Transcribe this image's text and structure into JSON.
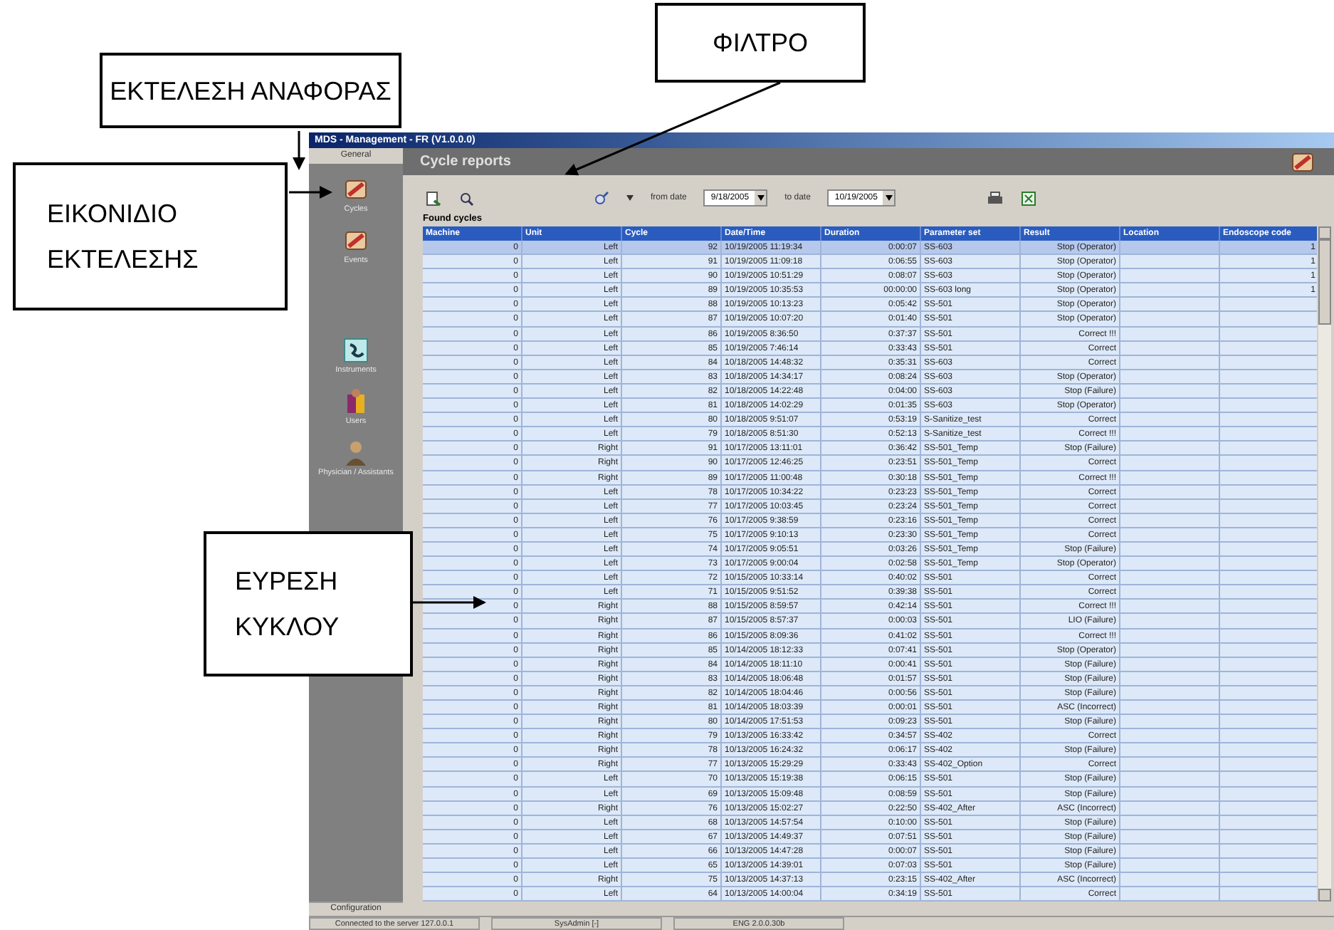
{
  "annotations": [
    {
      "text": "ΕΚΤΕΛΕΣΗ ΑΝΑΦΟΡΑΣ"
    },
    {
      "text": "ΦΙΛΤΡΟ"
    },
    {
      "text": "ΕΙΚΟΝΙΔΙΟ ΕΚΤΕΛΕΣΗΣ"
    },
    {
      "text": "ΕΥΡΕΣΗ ΚΥΚΛΟΥ"
    }
  ],
  "window": {
    "title": "MDS - Management - FR (V1.0.0.0)"
  },
  "sidebar": {
    "header": "General",
    "items": [
      {
        "label": "Cycles",
        "kind": "cycles"
      },
      {
        "label": "Events",
        "kind": "events"
      },
      {
        "label": "Instruments",
        "kind": "instruments"
      },
      {
        "label": "Users",
        "kind": "users"
      },
      {
        "label": "Physician / Assistants",
        "kind": "physician"
      }
    ],
    "footer": "Configuration"
  },
  "panel": {
    "title": "Cycle reports",
    "from_label": "from date",
    "from_date": "9/18/2005",
    "to_label": "to date",
    "to_date": "10/19/2005",
    "section": "Found cycles"
  },
  "table": {
    "columns": [
      "Machine",
      "Unit",
      "Cycle",
      "Date/Time",
      "Duration",
      "Parameter set",
      "Result",
      "Location",
      "Endoscope code"
    ],
    "rows": [
      {
        "selected": true,
        "cells": [
          "0",
          "Left",
          "92",
          "10/19/2005 11:19:34",
          "0:00:07",
          "SS-603",
          "Stop (Operator)",
          "",
          "1"
        ]
      },
      {
        "selected": false,
        "cells": [
          "0",
          "Left",
          "91",
          "10/19/2005 11:09:18",
          "0:06:55",
          "SS-603",
          "Stop (Operator)",
          "",
          "1"
        ]
      },
      {
        "selected": false,
        "cells": [
          "0",
          "Left",
          "90",
          "10/19/2005 10:51:29",
          "0:08:07",
          "SS-603",
          "Stop (Operator)",
          "",
          "1"
        ]
      },
      {
        "selected": false,
        "cells": [
          "0",
          "Left",
          "89",
          "10/19/2005 10:35:53",
          "00:00:00",
          "SS-603 long",
          "Stop (Operator)",
          "",
          "1"
        ]
      },
      {
        "selected": false,
        "cells": [
          "0",
          "Left",
          "88",
          "10/19/2005 10:13:23",
          "0:05:42",
          "SS-501",
          "Stop (Operator)",
          "",
          ""
        ]
      },
      {
        "selected": false,
        "cells": [
          "0",
          "Left",
          "87",
          "10/19/2005 10:07:20",
          "0:01:40",
          "SS-501",
          "Stop (Operator)",
          "",
          ""
        ]
      },
      {
        "selected": false,
        "cells": [
          "0",
          "Left",
          "86",
          "10/19/2005 8:36:50",
          "0:37:37",
          "SS-501",
          "Correct !!!",
          "",
          ""
        ]
      },
      {
        "selected": false,
        "cells": [
          "0",
          "Left",
          "85",
          "10/19/2005 7:46:14",
          "0:33:43",
          "SS-501",
          "Correct",
          "",
          ""
        ]
      },
      {
        "selected": false,
        "cells": [
          "0",
          "Left",
          "84",
          "10/18/2005 14:48:32",
          "0:35:31",
          "SS-603",
          "Correct",
          "",
          ""
        ]
      },
      {
        "selected": false,
        "cells": [
          "0",
          "Left",
          "83",
          "10/18/2005 14:34:17",
          "0:08:24",
          "SS-603",
          "Stop (Operator)",
          "",
          ""
        ]
      },
      {
        "selected": false,
        "cells": [
          "0",
          "Left",
          "82",
          "10/18/2005 14:22:48",
          "0:04:00",
          "SS-603",
          "Stop (Failure)",
          "",
          ""
        ]
      },
      {
        "selected": false,
        "cells": [
          "0",
          "Left",
          "81",
          "10/18/2005 14:02:29",
          "0:01:35",
          "SS-603",
          "Stop (Operator)",
          "",
          ""
        ]
      },
      {
        "selected": false,
        "cells": [
          "0",
          "Left",
          "80",
          "10/18/2005 9:51:07",
          "0:53:19",
          "S-Sanitize_test",
          "Correct",
          "",
          ""
        ]
      },
      {
        "selected": false,
        "cells": [
          "0",
          "Left",
          "79",
          "10/18/2005 8:51:30",
          "0:52:13",
          "S-Sanitize_test",
          "Correct !!!",
          "",
          ""
        ]
      },
      {
        "selected": false,
        "cells": [
          "0",
          "Right",
          "91",
          "10/17/2005 13:11:01",
          "0:36:42",
          "SS-501_Temp",
          "Stop (Failure)",
          "",
          ""
        ]
      },
      {
        "selected": false,
        "cells": [
          "0",
          "Right",
          "90",
          "10/17/2005 12:46:25",
          "0:23:51",
          "SS-501_Temp",
          "Correct",
          "",
          ""
        ]
      },
      {
        "selected": false,
        "cells": [
          "0",
          "Right",
          "89",
          "10/17/2005 11:00:48",
          "0:30:18",
          "SS-501_Temp",
          "Correct !!!",
          "",
          ""
        ]
      },
      {
        "selected": false,
        "cells": [
          "0",
          "Left",
          "78",
          "10/17/2005 10:34:22",
          "0:23:23",
          "SS-501_Temp",
          "Correct",
          "",
          ""
        ]
      },
      {
        "selected": false,
        "cells": [
          "0",
          "Left",
          "77",
          "10/17/2005 10:03:45",
          "0:23:24",
          "SS-501_Temp",
          "Correct",
          "",
          ""
        ]
      },
      {
        "selected": false,
        "cells": [
          "0",
          "Left",
          "76",
          "10/17/2005 9:38:59",
          "0:23:16",
          "SS-501_Temp",
          "Correct",
          "",
          ""
        ]
      },
      {
        "selected": false,
        "cells": [
          "0",
          "Left",
          "75",
          "10/17/2005 9:10:13",
          "0:23:30",
          "SS-501_Temp",
          "Correct",
          "",
          ""
        ]
      },
      {
        "selected": false,
        "cells": [
          "0",
          "Left",
          "74",
          "10/17/2005 9:05:51",
          "0:03:26",
          "SS-501_Temp",
          "Stop (Failure)",
          "",
          ""
        ]
      },
      {
        "selected": false,
        "cells": [
          "0",
          "Left",
          "73",
          "10/17/2005 9:00:04",
          "0:02:58",
          "SS-501_Temp",
          "Stop (Operator)",
          "",
          ""
        ]
      },
      {
        "selected": false,
        "cells": [
          "0",
          "Left",
          "72",
          "10/15/2005 10:33:14",
          "0:40:02",
          "SS-501",
          "Correct",
          "",
          ""
        ]
      },
      {
        "selected": false,
        "cells": [
          "0",
          "Left",
          "71",
          "10/15/2005 9:51:52",
          "0:39:38",
          "SS-501",
          "Correct",
          "",
          ""
        ]
      },
      {
        "selected": false,
        "cells": [
          "0",
          "Right",
          "88",
          "10/15/2005 8:59:57",
          "0:42:14",
          "SS-501",
          "Correct !!!",
          "",
          ""
        ]
      },
      {
        "selected": false,
        "cells": [
          "0",
          "Right",
          "87",
          "10/15/2005 8:57:37",
          "0:00:03",
          "SS-501",
          "LIO (Failure)",
          "",
          ""
        ]
      },
      {
        "selected": false,
        "cells": [
          "0",
          "Right",
          "86",
          "10/15/2005 8:09:36",
          "0:41:02",
          "SS-501",
          "Correct !!!",
          "",
          ""
        ]
      },
      {
        "selected": false,
        "cells": [
          "0",
          "Right",
          "85",
          "10/14/2005 18:12:33",
          "0:07:41",
          "SS-501",
          "Stop (Operator)",
          "",
          ""
        ]
      },
      {
        "selected": false,
        "cells": [
          "0",
          "Right",
          "84",
          "10/14/2005 18:11:10",
          "0:00:41",
          "SS-501",
          "Stop (Failure)",
          "",
          ""
        ]
      },
      {
        "selected": false,
        "cells": [
          "0",
          "Right",
          "83",
          "10/14/2005 18:06:48",
          "0:01:57",
          "SS-501",
          "Stop (Failure)",
          "",
          ""
        ]
      },
      {
        "selected": false,
        "cells": [
          "0",
          "Right",
          "82",
          "10/14/2005 18:04:46",
          "0:00:56",
          "SS-501",
          "Stop (Failure)",
          "",
          ""
        ]
      },
      {
        "selected": false,
        "cells": [
          "0",
          "Right",
          "81",
          "10/14/2005 18:03:39",
          "0:00:01",
          "SS-501",
          "ASC (Incorrect)",
          "",
          ""
        ]
      },
      {
        "selected": false,
        "cells": [
          "0",
          "Right",
          "80",
          "10/14/2005 17:51:53",
          "0:09:23",
          "SS-501",
          "Stop (Failure)",
          "",
          ""
        ]
      },
      {
        "selected": false,
        "cells": [
          "0",
          "Right",
          "79",
          "10/13/2005 16:33:42",
          "0:34:57",
          "SS-402",
          "Correct",
          "",
          ""
        ]
      },
      {
        "selected": false,
        "cells": [
          "0",
          "Right",
          "78",
          "10/13/2005 16:24:32",
          "0:06:17",
          "SS-402",
          "Stop (Failure)",
          "",
          ""
        ]
      },
      {
        "selected": false,
        "cells": [
          "0",
          "Right",
          "77",
          "10/13/2005 15:29:29",
          "0:33:43",
          "SS-402_Option",
          "Correct",
          "",
          ""
        ]
      },
      {
        "selected": false,
        "cells": [
          "0",
          "Left",
          "70",
          "10/13/2005 15:19:38",
          "0:06:15",
          "SS-501",
          "Stop (Failure)",
          "",
          ""
        ]
      },
      {
        "selected": false,
        "cells": [
          "0",
          "Left",
          "69",
          "10/13/2005 15:09:48",
          "0:08:59",
          "SS-501",
          "Stop (Failure)",
          "",
          ""
        ]
      },
      {
        "selected": false,
        "cells": [
          "0",
          "Right",
          "76",
          "10/13/2005 15:02:27",
          "0:22:50",
          "SS-402_After",
          "ASC (Incorrect)",
          "",
          ""
        ]
      },
      {
        "selected": false,
        "cells": [
          "0",
          "Left",
          "68",
          "10/13/2005 14:57:54",
          "0:10:00",
          "SS-501",
          "Stop (Failure)",
          "",
          ""
        ]
      },
      {
        "selected": false,
        "cells": [
          "0",
          "Left",
          "67",
          "10/13/2005 14:49:37",
          "0:07:51",
          "SS-501",
          "Stop (Failure)",
          "",
          ""
        ]
      },
      {
        "selected": false,
        "cells": [
          "0",
          "Left",
          "66",
          "10/13/2005 14:47:28",
          "0:00:07",
          "SS-501",
          "Stop (Failure)",
          "",
          ""
        ]
      },
      {
        "selected": false,
        "cells": [
          "0",
          "Left",
          "65",
          "10/13/2005 14:39:01",
          "0:07:03",
          "SS-501",
          "Stop (Failure)",
          "",
          ""
        ]
      },
      {
        "selected": false,
        "cells": [
          "0",
          "Right",
          "75",
          "10/13/2005 14:37:13",
          "0:23:15",
          "SS-402_After",
          "ASC (Incorrect)",
          "",
          ""
        ]
      },
      {
        "selected": false,
        "cells": [
          "0",
          "Left",
          "64",
          "10/13/2005 14:00:04",
          "0:34:19",
          "SS-501",
          "Correct",
          "",
          ""
        ]
      }
    ]
  },
  "status_bar": [
    "Connected to the server 127.0.0.1",
    "SysAdmin [-]",
    "ENG 2.0.0.30b"
  ]
}
